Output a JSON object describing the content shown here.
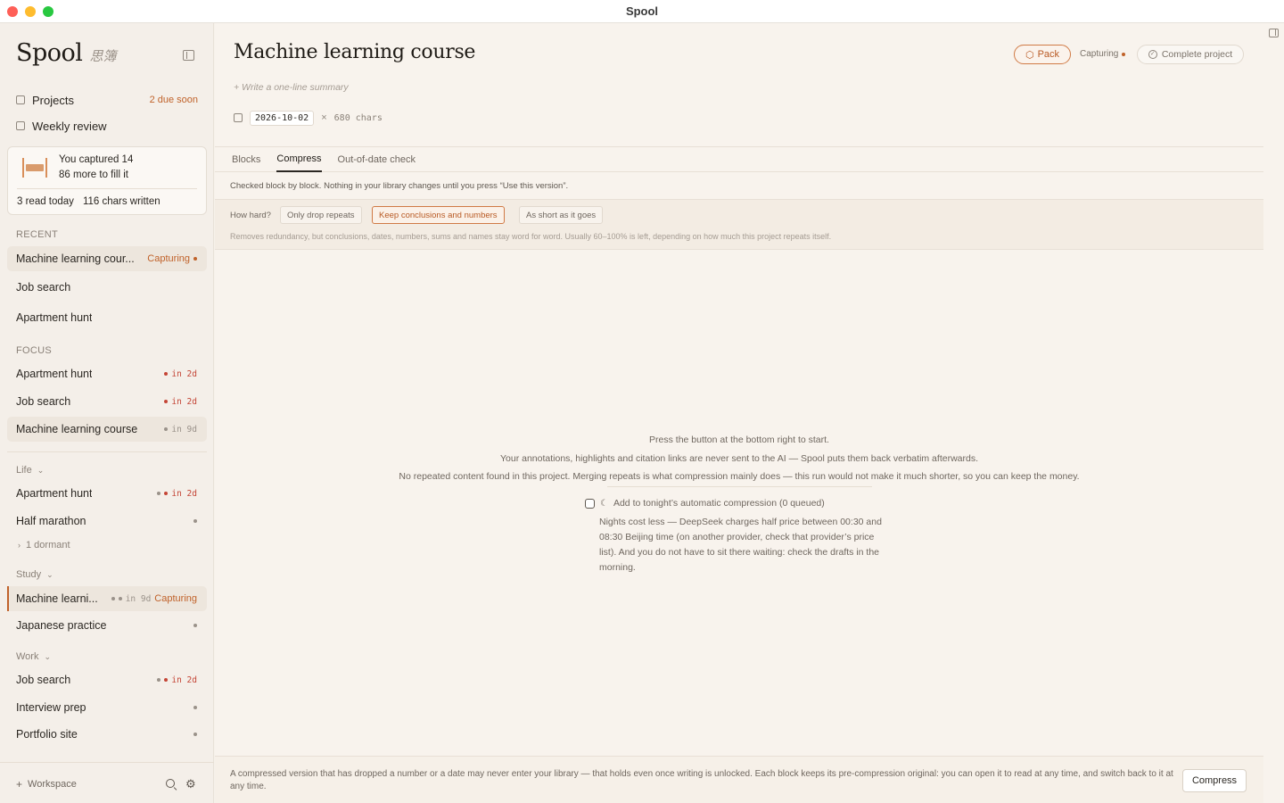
{
  "window": {
    "title": "Spool"
  },
  "brand": {
    "name": "Spool",
    "subtitle": "思簿"
  },
  "nav": {
    "projects": {
      "label": "Projects",
      "badge": "2 due soon"
    },
    "weekly": {
      "label": "Weekly review"
    }
  },
  "capture_card": {
    "line1": "You captured 14",
    "line2": "86 more to fill it",
    "read_today": "3 read today",
    "chars_written": "116 chars written"
  },
  "sections": {
    "recent": "RECENT",
    "focus": "FOCUS"
  },
  "recent": [
    {
      "label": "Machine learning cour...",
      "status": "Capturing"
    },
    {
      "label": "Job search"
    },
    {
      "label": "Apartment hunt"
    }
  ],
  "focus": [
    {
      "label": "Apartment hunt",
      "due": "in 2d"
    },
    {
      "label": "Job search",
      "due": "in 2d"
    },
    {
      "label": "Machine learning course",
      "due": "in 9d"
    }
  ],
  "groups": {
    "life": {
      "label": "Life",
      "items": [
        {
          "label": "Apartment hunt",
          "due": "in 2d"
        },
        {
          "label": "Half marathon"
        }
      ],
      "dormant": "1 dormant"
    },
    "study": {
      "label": "Study",
      "items": [
        {
          "label": "Machine learni...",
          "due": "in 9d",
          "status": "Capturing"
        },
        {
          "label": "Japanese practice"
        }
      ]
    },
    "work": {
      "label": "Work",
      "items": [
        {
          "label": "Job search",
          "due": "in 2d"
        },
        {
          "label": "Interview prep"
        },
        {
          "label": "Portfolio site"
        }
      ]
    }
  },
  "footer": {
    "workspace": "Workspace"
  },
  "project": {
    "title": "Machine learning course",
    "summary_placeholder": "+ Write a one-line summary",
    "date": "2026-10-02",
    "chars": "680 chars",
    "pack_label": "Pack",
    "capturing_label": "Capturing",
    "complete_label": "Complete project"
  },
  "tabs": [
    "Blocks",
    "Compress",
    "Out-of-date check"
  ],
  "compress": {
    "info": "Checked block by block. Nothing in your library changes until you press “Use this version”.",
    "how_hard": "How hard?",
    "options": [
      "Only drop repeats",
      "Keep conclusions and numbers",
      "As short as it goes"
    ],
    "selected_option": "Keep conclusions and numbers",
    "description": "Removes redundancy, but conclusions, dates, numbers, sums and names stay word for word. Usually 60–100% is left, depending on how much this project repeats itself.",
    "center_line1": "Press the button at the bottom right to start.",
    "center_line2": "Your annotations, highlights and citation links are never sent to the AI — Spool puts them back verbatim afterwards.",
    "center_line3": "No repeated content found in this project. Merging repeats is what compression mainly does — this run would not make it much shorter, so you can keep the money.",
    "tonight_label": "Add to tonight’s automatic compression (0 queued)",
    "tonight_checked": false,
    "night_note": "Nights cost less — DeepSeek charges half price between 00:30 and 08:30 Beijing time (on another provider, check that provider’s price list). And you do not have to sit there waiting: check the drafts in the morning.",
    "bottom_note": "A compressed version that has dropped a number or a date may never enter your library — that holds even once writing is unlocked. Each block keeps its pre-compression original: you can open it to read at any time, and switch back to it at any time.",
    "button": "Compress"
  },
  "colors": {
    "accent": "#c0622a",
    "due_red": "#c44536",
    "background": "#f8f3ed"
  }
}
